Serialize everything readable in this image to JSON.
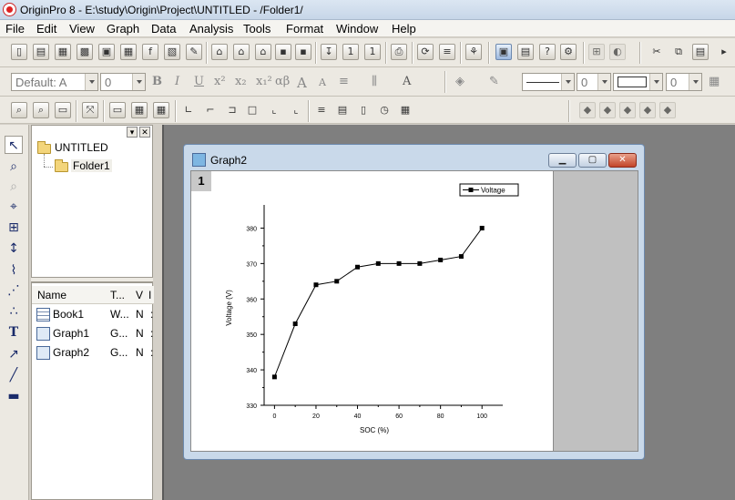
{
  "window": {
    "title": "OriginPro 8 - E:\\study\\Origin\\Project\\UNTITLED - /Folder1/"
  },
  "menu": {
    "items": [
      "File",
      "Edit",
      "View",
      "Graph",
      "Data",
      "Analysis",
      "Tools",
      "Format",
      "Window",
      "Help"
    ]
  },
  "format_toolbar": {
    "font_name": "Default: A",
    "font_size": "0",
    "line_width": "0",
    "fill_value": "0",
    "bold": "B",
    "italic": "I",
    "underline": "U",
    "superscript": "x²",
    "subscript": "x₂",
    "supsub": "x₁²",
    "greek": "αβ",
    "font_up": "A",
    "font_down": "A"
  },
  "explorer": {
    "root": "UNTITLED",
    "folder": "Folder1",
    "columns": [
      "Name",
      "T...",
      "V",
      "I"
    ],
    "items": [
      {
        "name": "Book1",
        "type": "W...",
        "view": "N",
        "extra": ":"
      },
      {
        "name": "Graph1",
        "type": "G...",
        "view": "N",
        "extra": ":"
      },
      {
        "name": "Graph2",
        "type": "G...",
        "view": "N",
        "extra": ":"
      }
    ]
  },
  "graph_window": {
    "title": "Graph2",
    "layer": "1"
  },
  "chart_data": {
    "type": "line",
    "x": [
      0,
      10,
      20,
      30,
      40,
      50,
      60,
      70,
      80,
      90,
      100
    ],
    "series": [
      {
        "name": "Voltage",
        "values": [
          338,
          353,
          364,
          365,
          369,
          370,
          370,
          370,
          371,
          372,
          380
        ]
      }
    ],
    "xlabel": "SOC (%)",
    "ylabel": "Voltage (V)",
    "xticks": [
      "0",
      "20",
      "40",
      "60",
      "80",
      "100"
    ],
    "yticks": [
      "330",
      "340",
      "350",
      "360",
      "370",
      "380"
    ],
    "xlim": [
      -5,
      110
    ],
    "ylim": [
      330,
      385
    ],
    "grid": false,
    "legend": "top-right",
    "marker": "square",
    "color": "#000000"
  }
}
